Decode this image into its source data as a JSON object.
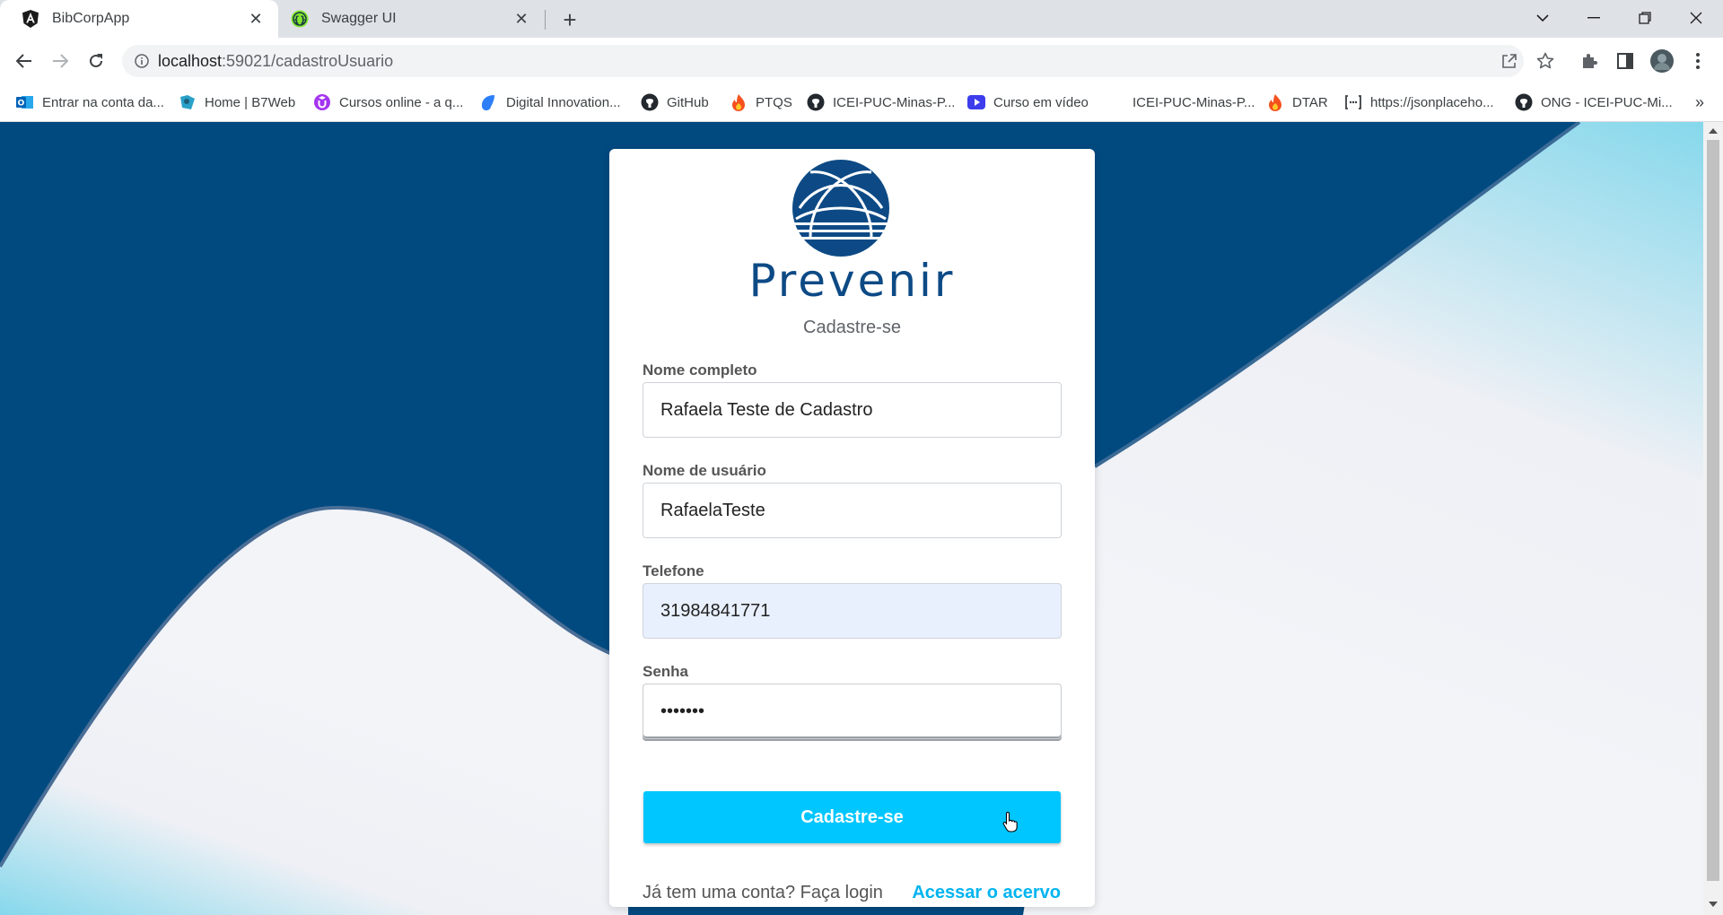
{
  "browser": {
    "tabs": [
      {
        "title": "BibCorpApp",
        "active": true,
        "favicon": "angular-icon"
      },
      {
        "title": "Swagger UI",
        "active": false,
        "favicon": "swagger-icon"
      }
    ],
    "url": {
      "host": "localhost",
      "rest": ":59021/cadastroUsuario"
    },
    "bookmarks": [
      {
        "label": "Entrar na conta da...",
        "icon": "outlook-icon"
      },
      {
        "label": "Home | B7Web",
        "icon": "b7web-icon"
      },
      {
        "label": "Cursos online - a q...",
        "icon": "udemy-icon"
      },
      {
        "label": "Digital Innovation...",
        "icon": "dio-icon"
      },
      {
        "label": "GitHub",
        "icon": "github-icon"
      },
      {
        "label": "PTQS",
        "icon": "fire-icon"
      },
      {
        "label": "ICEI-PUC-Minas-P...",
        "icon": "github-icon"
      },
      {
        "label": "Curso em vídeo",
        "icon": "video-icon"
      },
      {
        "label": "ICEI-PUC-Minas-P...",
        "icon": "none"
      },
      {
        "label": "DTAR",
        "icon": "fire-icon"
      },
      {
        "label": "https://jsonplaceho...",
        "icon": "json-icon"
      },
      {
        "label": "ONG - ICEI-PUC-Mi...",
        "icon": "github-icon"
      }
    ]
  },
  "page": {
    "brand": "Prevenir",
    "subtitle": "Cadastre-se",
    "fields": {
      "full_name": {
        "label": "Nome completo",
        "value": "Rafaela Teste de Cadastro"
      },
      "username": {
        "label": "Nome de usuário",
        "value": "RafaelaTeste"
      },
      "phone": {
        "label": "Telefone",
        "value": "31984841771"
      },
      "password": {
        "label": "Senha",
        "value": "•••••••"
      }
    },
    "submit_label": "Cadastre-se",
    "footer_text": "Já tem uma conta? Faça login",
    "login_link": "Acessar o acervo"
  },
  "colors": {
    "navy": "#004a80",
    "accent": "#00c6ff",
    "wave_light": "#a8e4f2",
    "brand": "#0d4a85"
  }
}
